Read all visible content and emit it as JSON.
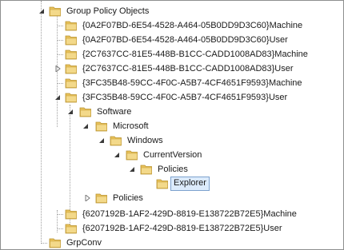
{
  "tree": {
    "rows": [
      {
        "label": "Group Policy Objects",
        "state": "expanded"
      },
      {
        "label": "{0A2F07BD-6E54-4528-A464-05B0DD9D3C60}Machine",
        "state": "leaf"
      },
      {
        "label": "{0A2F07BD-6E54-4528-A464-05B0DD9D3C60}User",
        "state": "leaf"
      },
      {
        "label": "{2C7637CC-81E5-448B-B1CC-CADD1008AD83}Machine",
        "state": "leaf"
      },
      {
        "label": "{2C7637CC-81E5-448B-B1CC-CADD1008AD83}User",
        "state": "collapsed"
      },
      {
        "label": "{3FC35B48-59CC-4F0C-A5B7-4CF4651F9593}Machine",
        "state": "leaf"
      },
      {
        "label": "{3FC35B48-59CC-4F0C-A5B7-4CF4651F9593}User",
        "state": "expanded"
      },
      {
        "label": "Software",
        "state": "expanded"
      },
      {
        "label": "Microsoft",
        "state": "expanded"
      },
      {
        "label": "Windows",
        "state": "expanded"
      },
      {
        "label": "CurrentVersion",
        "state": "expanded"
      },
      {
        "label": "Policies",
        "state": "expanded"
      },
      {
        "label": "Explorer",
        "state": "selected"
      },
      {
        "label": "Policies",
        "state": "collapsed"
      },
      {
        "label": "{6207192B-1AF2-429D-8819-E138722B72E5}Machine",
        "state": "leaf"
      },
      {
        "label": "{6207192B-1AF2-429D-8819-E138722B72E5}User",
        "state": "leaf"
      },
      {
        "label": "GrpConv",
        "state": "leaf"
      }
    ]
  },
  "colors": {
    "selection_bg": "#dcebfc",
    "selection_border": "#7da2ce",
    "folder_body": "#e8c15a",
    "folder_tab": "#f3d98a"
  }
}
